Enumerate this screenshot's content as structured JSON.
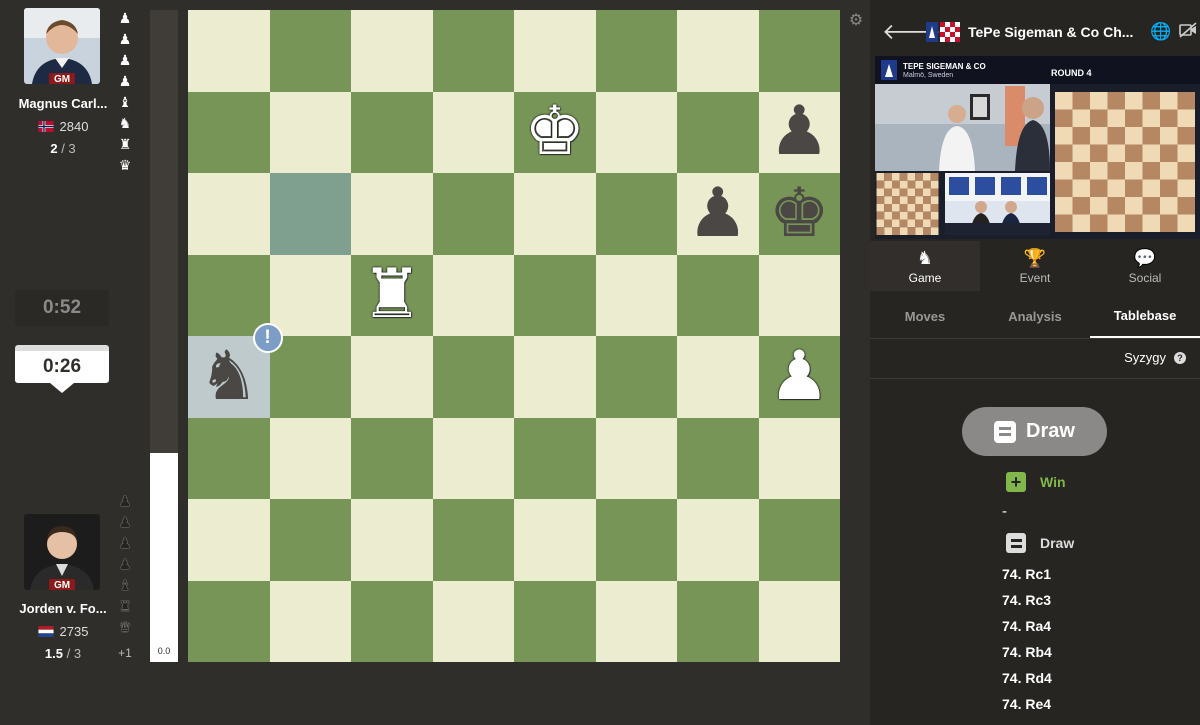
{
  "top_player": {
    "name": "Magnus Carl...",
    "title": "GM",
    "rating": "2840",
    "score_main": "2",
    "score_total": "/ 3",
    "captured": [
      "♟",
      "♟",
      "♟",
      "♟",
      "♝",
      "♞",
      "♜",
      "♛"
    ],
    "clock": "0:52"
  },
  "bottom_player": {
    "name": "Jorden v. Fo...",
    "title": "GM",
    "rating": "2735",
    "score_main": "1.5",
    "score_total": "/ 3",
    "captured": [
      "♟",
      "♟",
      "♟",
      "♟",
      "♝",
      "♜",
      "♛"
    ],
    "advantage": "+1",
    "clock": "0:26"
  },
  "eval": {
    "value": "0.0",
    "white_fraction": 0.5
  },
  "board": {
    "pieces": [
      {
        "file": 4,
        "rank": 6,
        "glyph": "♚",
        "color": "w",
        "name": "white-king"
      },
      {
        "file": 7,
        "rank": 6,
        "glyph": "♟",
        "color": "b",
        "name": "black-pawn-h6"
      },
      {
        "file": 6,
        "rank": 5,
        "glyph": "♟",
        "color": "b",
        "name": "black-pawn-g5"
      },
      {
        "file": 7,
        "rank": 5,
        "glyph": "♚",
        "color": "b",
        "name": "black-king"
      },
      {
        "file": 2,
        "rank": 4,
        "glyph": "♜",
        "color": "w",
        "name": "white-rook"
      },
      {
        "file": 0,
        "rank": 3,
        "glyph": "♞",
        "color": "b",
        "name": "black-knight"
      },
      {
        "file": 7,
        "rank": 3,
        "glyph": "♟",
        "color": "w",
        "name": "white-pawn-h3"
      }
    ],
    "highlights": [
      {
        "file": 1,
        "rank": 5
      },
      {
        "file": 0,
        "rank": 3
      }
    ],
    "annotation": {
      "file": 0,
      "rank": 3,
      "symbol": "!"
    }
  },
  "header": {
    "title": "TePe Sigeman & Co Ch...",
    "back_icon": "arrow-left-icon"
  },
  "stream": {
    "event_title": "TEPE SIGEMAN & CO",
    "event_location": "Malmö, Sweden",
    "round": "ROUND 4"
  },
  "main_tabs": [
    {
      "label": "Game",
      "icon": "♞",
      "icon_name": "board-icon",
      "active": true
    },
    {
      "label": "Event",
      "icon": "🏆",
      "icon_name": "trophy-icon",
      "active": false
    },
    {
      "label": "Social",
      "icon": "💬",
      "icon_name": "chat-icon",
      "active": false
    }
  ],
  "sub_tabs": [
    {
      "label": "Moves",
      "active": false
    },
    {
      "label": "Analysis",
      "active": false
    },
    {
      "label": "Tablebase",
      "active": true
    }
  ],
  "tablebase": {
    "source": "Syzygy",
    "result": "Draw",
    "win_label": "Win",
    "win_moves": "-",
    "draw_label": "Draw",
    "draw_moves": [
      "74. Rc1",
      "74. Rc3",
      "74. Ra4",
      "74. Rb4",
      "74. Rd4",
      "74. Re4"
    ]
  },
  "colors": {
    "light_square": "#ebecd0",
    "dark_square": "#779556",
    "win_green": "#81b64c"
  }
}
